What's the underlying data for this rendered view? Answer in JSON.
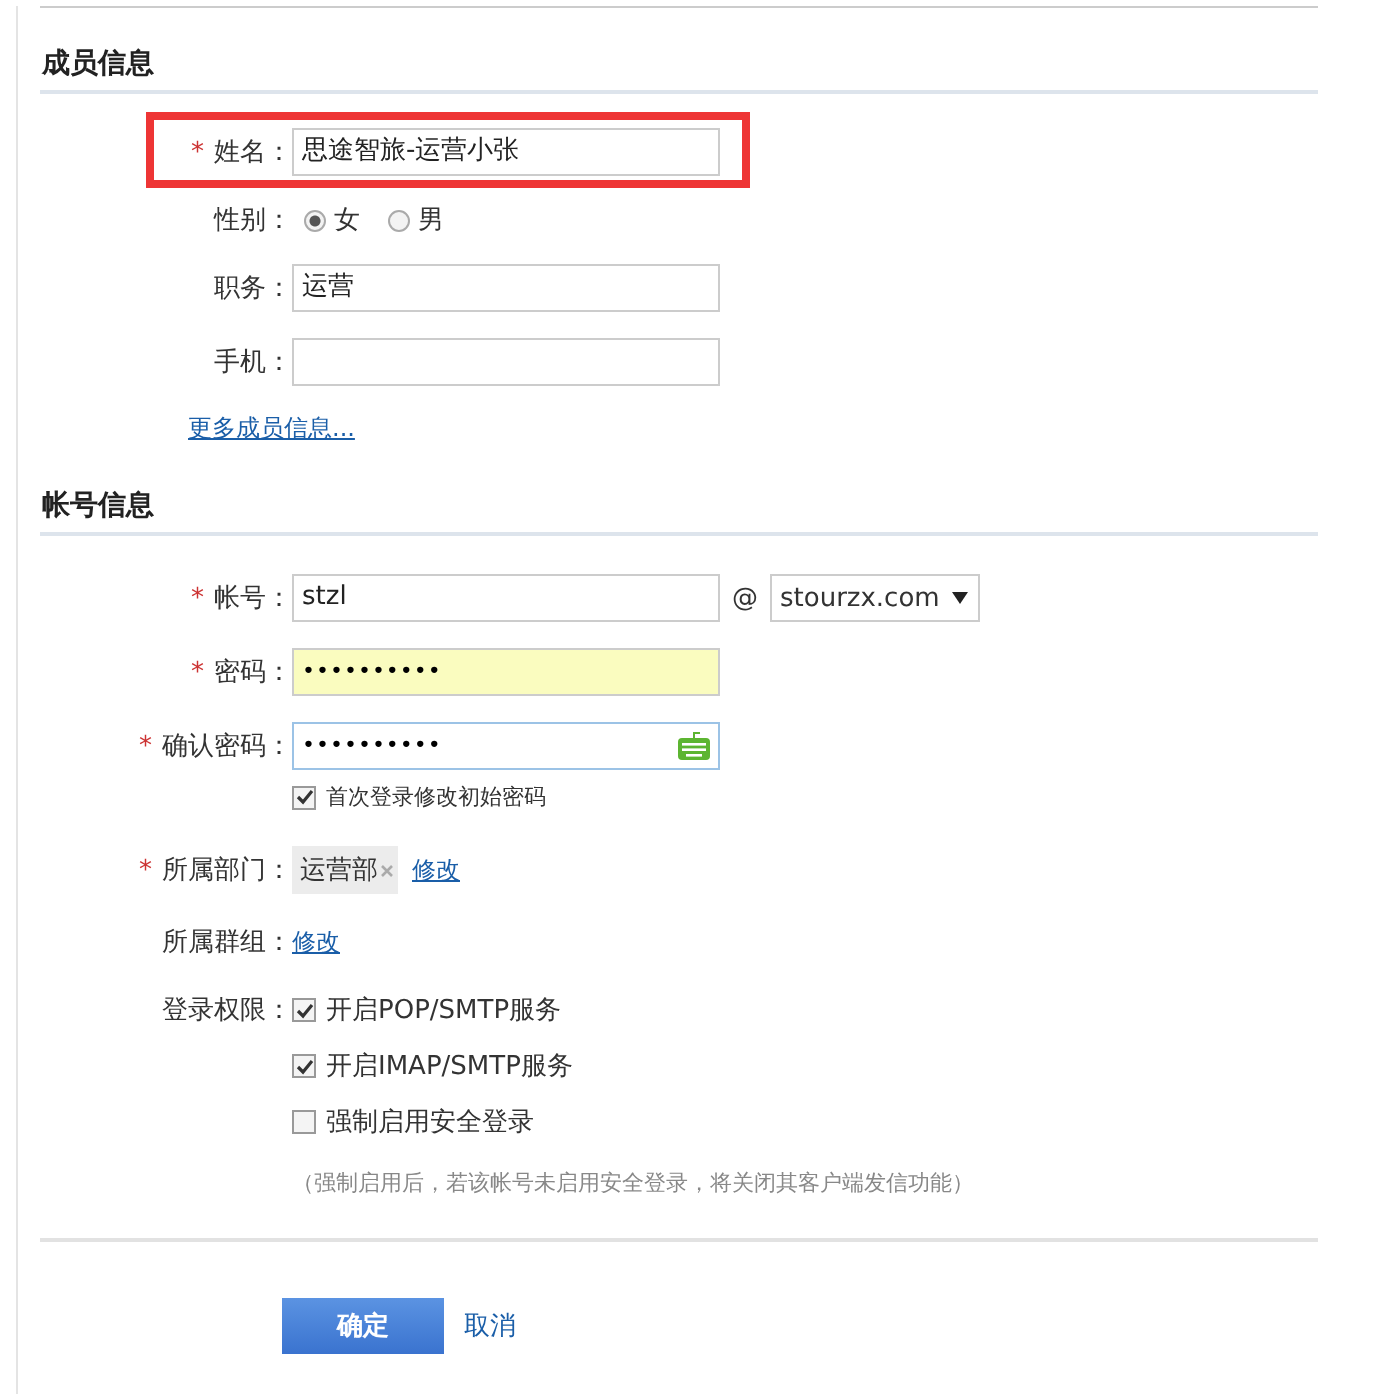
{
  "sections": [
    {
      "title": "成员信息",
      "rows": [
        {
          "kind": "text",
          "marker": "*",
          "label": "姓名：",
          "value": "思途智旅-运营小张",
          "highlighted": true
        },
        {
          "kind": "radio",
          "label": "性别：",
          "options": [
            {
              "label": "女",
              "selected": true
            },
            {
              "label": "男",
              "selected": false
            }
          ]
        },
        {
          "kind": "text",
          "label": "职务：",
          "value": "运营",
          "highlighted": false
        },
        {
          "kind": "text",
          "label": "手机：",
          "highlighted": false
        }
      ],
      "link": "更多成员信息..."
    },
    {
      "title": "帐号信息",
      "rows": [
        {
          "kind": "account",
          "marker": "*",
          "label": "帐号：",
          "value": "stzl",
          "at": "@",
          "domain": "stourzx.com"
        },
        {
          "kind": "password",
          "marker": "*",
          "label": "密码：",
          "value": "••••••••••",
          "autofilled": true,
          "focused": false
        },
        {
          "kind": "password",
          "marker": "*",
          "label": "确认密码：",
          "value": "••••••••••",
          "autofilled": false,
          "focused": true
        },
        {
          "kind": "checkbox",
          "label": "首次登录修改初始密码",
          "checked": true
        },
        {
          "kind": "tag",
          "marker": "*",
          "label": "所属部门：",
          "tag": "运营部",
          "link": "修改"
        },
        {
          "kind": "linkonly",
          "label": "所属群组：",
          "link": "修改"
        },
        {
          "kind": "checklist",
          "label": "登录权限：",
          "options": [
            {
              "label": "开启POP/SMTP服务",
              "checked": true
            },
            {
              "label": "开启IMAP/SMTP服务",
              "checked": true
            },
            {
              "label": "强制启用安全登录",
              "checked": false
            }
          ],
          "note": "（强制启用后，若该帐号未启用安全登录，将关闭其客户端发信功能）"
        }
      ]
    }
  ],
  "buttons": [
    {
      "kind": "primary",
      "label": "确定"
    },
    {
      "kind": "link",
      "label": "取消"
    }
  ]
}
